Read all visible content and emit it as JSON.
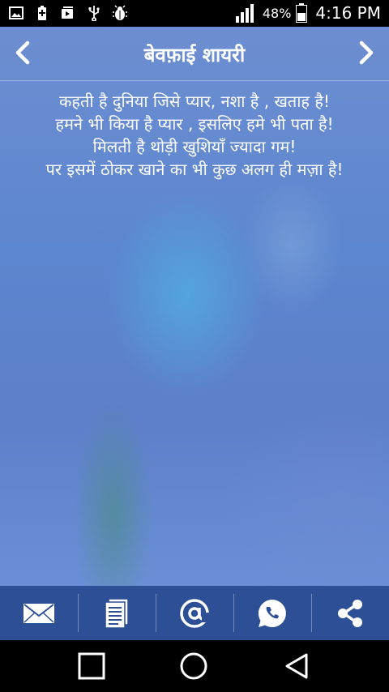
{
  "status_bar": {
    "battery_percent": "48%",
    "time": "4:16 PM",
    "icons": [
      "image-icon",
      "battery-saver-icon",
      "video-icon",
      "usb-icon",
      "bug-icon",
      "signal-icon",
      "battery-icon"
    ]
  },
  "header": {
    "title": "बेवफ़ाई शायरी",
    "prev_icon": "chevron-left-icon",
    "next_icon": "chevron-right-icon"
  },
  "poem": {
    "lines": [
      "कहती है दुनिया जिसे प्यार, नशा है , खताह है!",
      "हमने भी किया है प्यार , इसलिए हमे भी पता है!",
      "मिलती है थोड़ी खुशियाँ ज्यादा गम!",
      "पर इसमें ठोकर खाने का भी कुछ अलग ही मज़ा है!"
    ]
  },
  "actions": [
    "mail-icon",
    "copy-icon",
    "at-icon",
    "whatsapp-icon",
    "share-icon"
  ],
  "system_nav": [
    "recent-apps-icon",
    "home-icon",
    "back-icon"
  ],
  "colors": {
    "action_bar": "#2c4f95",
    "background": "#5c86cf"
  }
}
